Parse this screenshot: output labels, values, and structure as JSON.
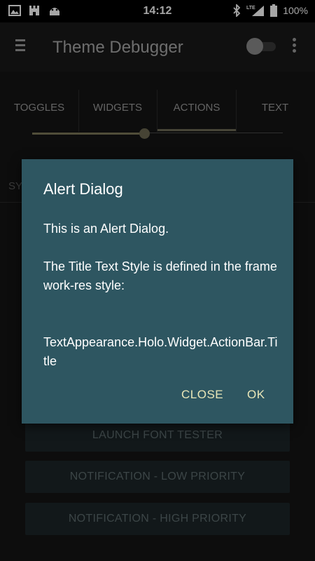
{
  "status_bar": {
    "time": "14:12",
    "network": "LTE",
    "battery": "100%",
    "icons": [
      "image-icon",
      "castle-icon",
      "android-icon",
      "bluetooth-icon",
      "signal-icon",
      "battery-icon"
    ]
  },
  "action_bar": {
    "title": "Theme Debugger",
    "icons": [
      "menu-icon",
      "toggle-switch",
      "overflow-menu-icon"
    ]
  },
  "tabs": [
    {
      "label": "TOGGLES"
    },
    {
      "label": "WIDGETS"
    },
    {
      "label": "ACTIONS",
      "selected": true
    },
    {
      "label": "TEXT"
    }
  ],
  "tab_scroll_fraction": 0.45,
  "background": {
    "sub_tab_label": "SY",
    "buttons": [
      {
        "label": "LAUNCH FONT TESTER"
      },
      {
        "label": "NOTIFICATION - LOW PRIORITY"
      },
      {
        "label": "NOTIFICATION - HIGH PRIORITY"
      }
    ]
  },
  "dialog": {
    "title": "Alert Dialog",
    "message": "This is an Alert Dialog.\n\nThe Title Text Style is defined in the framework-res style:\n\n\nTextAppearance.Holo.Widget.ActionBar.Title",
    "buttons": {
      "negative": "CLOSE",
      "positive": "OK"
    }
  },
  "colors": {
    "dialog_bg": "#2e5661",
    "button_text": "#e8e6b8",
    "accent": "#7c7758"
  }
}
